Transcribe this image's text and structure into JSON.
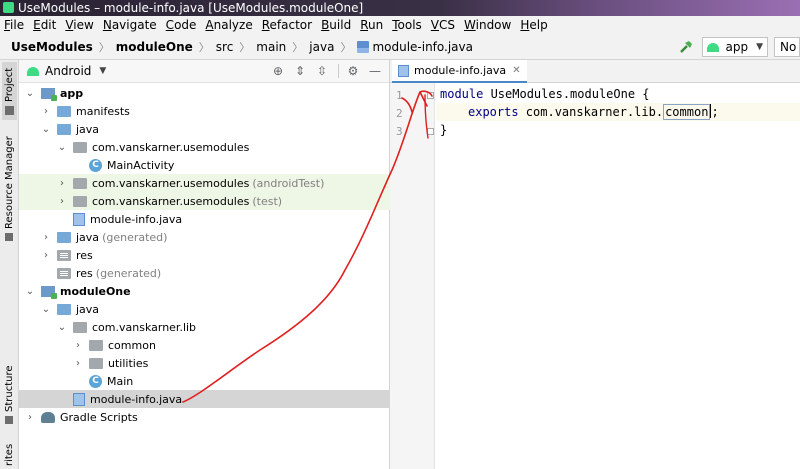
{
  "window": {
    "title": "UseModules – module-info.java [UseModules.moduleOne]"
  },
  "menu": [
    "File",
    "Edit",
    "View",
    "Navigate",
    "Code",
    "Analyze",
    "Refactor",
    "Build",
    "Run",
    "Tools",
    "VCS",
    "Window",
    "Help"
  ],
  "breadcrumb": [
    "UseModules",
    "moduleOne",
    "src",
    "main",
    "java",
    "module-info.java"
  ],
  "toolbar": {
    "run_config": "app",
    "device": "No"
  },
  "toolstrip": {
    "project": "Project",
    "resource_manager": "Resource Manager",
    "structure": "Structure",
    "favorites": "rites"
  },
  "panel": {
    "title": "Android"
  },
  "tree": [
    {
      "label": "app",
      "suffix": ""
    },
    {
      "label": "manifests",
      "suffix": ""
    },
    {
      "label": "java",
      "suffix": ""
    },
    {
      "label": "com.vanskarner.usemodules",
      "suffix": ""
    },
    {
      "label": "MainActivity",
      "suffix": ""
    },
    {
      "label": "com.vanskarner.usemodules",
      "suffix": "(androidTest)"
    },
    {
      "label": "com.vanskarner.usemodules",
      "suffix": "(test)"
    },
    {
      "label": "module-info.java",
      "suffix": ""
    },
    {
      "label": "java",
      "suffix": "(generated)"
    },
    {
      "label": "res",
      "suffix": ""
    },
    {
      "label": "res",
      "suffix": "(generated)"
    },
    {
      "label": "moduleOne",
      "suffix": ""
    },
    {
      "label": "java",
      "suffix": ""
    },
    {
      "label": "com.vanskarner.lib",
      "suffix": ""
    },
    {
      "label": "common",
      "suffix": ""
    },
    {
      "label": "utilities",
      "suffix": ""
    },
    {
      "label": "Main",
      "suffix": ""
    },
    {
      "label": "module-info.java",
      "suffix": ""
    },
    {
      "label": "Gradle Scripts",
      "suffix": ""
    }
  ],
  "editor": {
    "tab": "module-info.java",
    "line_numbers": [
      "1",
      "2",
      "3"
    ],
    "lines": [
      {
        "kw": "module",
        "text": " UseModules.moduleOne {"
      },
      {
        "kw": "exports",
        "text": " com.vanskarner.lib.",
        "ref": "common",
        "end": ";"
      },
      {
        "kw": "",
        "text": "}"
      }
    ]
  }
}
